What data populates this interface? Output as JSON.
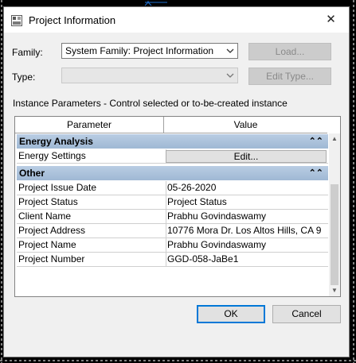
{
  "dialog": {
    "title": "Project Information",
    "close_glyph": "✕"
  },
  "family": {
    "label": "Family:",
    "value": "System Family: Project Information",
    "load_button": "Load..."
  },
  "type": {
    "label": "Type:",
    "value": "",
    "edit_type_button": "Edit Type..."
  },
  "instance_parameters_label": "Instance Parameters - Control selected or to-be-created instance",
  "grid": {
    "headers": {
      "parameter": "Parameter",
      "value": "Value"
    },
    "groups": [
      {
        "title": "Energy Analysis",
        "collapse_glyph": "⌃⌃",
        "rows": [
          {
            "name": "Energy Settings",
            "button": "Edit..."
          }
        ]
      },
      {
        "title": "Other",
        "collapse_glyph": "⌃⌃",
        "rows": [
          {
            "name": "Project Issue Date",
            "value": "05-26-2020"
          },
          {
            "name": "Project Status",
            "value": "Project Status"
          },
          {
            "name": "Client Name",
            "value": "Prabhu Govindaswamy"
          },
          {
            "name": "Project Address",
            "value": "10776 Mora Dr. Los Altos Hills, CA 9"
          },
          {
            "name": "Project Name",
            "value": "Prabhu Govindaswamy"
          },
          {
            "name": "Project Number",
            "value": "GGD-058-JaBe1"
          }
        ]
      }
    ]
  },
  "buttons": {
    "ok": "OK",
    "cancel": "Cancel"
  },
  "icons": {
    "app": "revit-app-icon",
    "close": "close-icon",
    "dropdown": "chevron-down-icon",
    "collapse": "double-chevron-up-icon"
  },
  "colors": {
    "group_header": "#a9c0da",
    "default_button_border": "#0078d7",
    "dialog_background": "#f0f0f0"
  }
}
